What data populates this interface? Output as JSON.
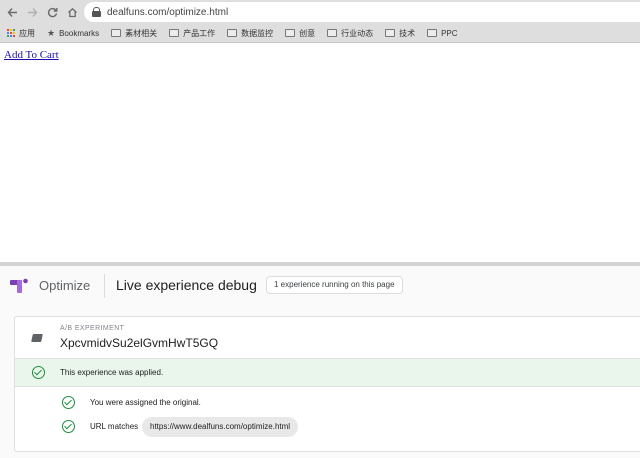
{
  "browser": {
    "url": "dealfuns.com/optimize.html",
    "bookmarks": [
      {
        "label": "应用",
        "icon": "apps-icon"
      },
      {
        "label": "Bookmarks",
        "icon": "star-icon"
      },
      {
        "label": "素材相关",
        "icon": "folder-icon"
      },
      {
        "label": "产品工作",
        "icon": "folder-icon"
      },
      {
        "label": "数据监控",
        "icon": "folder-icon"
      },
      {
        "label": "创意",
        "icon": "folder-icon"
      },
      {
        "label": "行业动态",
        "icon": "folder-icon"
      },
      {
        "label": "技术",
        "icon": "folder-icon"
      },
      {
        "label": "PPC",
        "icon": "folder-icon"
      }
    ]
  },
  "page": {
    "link_label": "Add To Cart"
  },
  "optimize": {
    "brand": "Optimize",
    "title": "Live experience debug",
    "status_pill": "1 experience running on this page",
    "experiment": {
      "type_label": "A/B EXPERIMENT",
      "name": "XpcvmidvSu2elGvmHwT5GQ",
      "applied_text": "This experience was applied.",
      "assignment_text": "You were assigned the original.",
      "url_label": "URL matches",
      "url_value": "https://www.dealfuns.com/optimize.html"
    }
  },
  "colors": {
    "accent_purple": "#7b3fb5",
    "success_green": "#1e8e3e",
    "applied_bg": "#eaf6ec"
  }
}
